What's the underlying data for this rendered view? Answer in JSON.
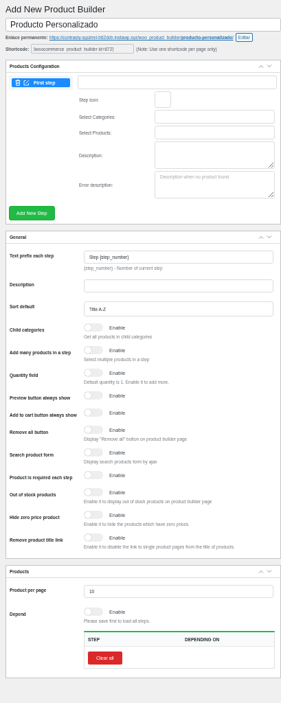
{
  "page_title": "Add New Product Builder",
  "title_value": "Producto Personalizado",
  "permalink": {
    "label": "Enlace permanente:",
    "url_base": "https://contrasty-squirrel-b62dcb.instawp.xyz/woo_product_builder/",
    "url_slug": "producto-personalizado",
    "url_end": "/",
    "edit_button": "Editar"
  },
  "shortcode": {
    "label": "Shortcode:",
    "value": "[woocommerce_product_builder id=672]",
    "note": "(Note: Use one shortcode per page only)"
  },
  "products_configuration": {
    "title": "Products Configuration",
    "steps": [
      {
        "label": "First step",
        "selected": true
      }
    ],
    "fields": [
      {
        "kind": "icon",
        "label": "Step icon:"
      },
      {
        "kind": "input",
        "label": "Select Categories:"
      },
      {
        "kind": "input",
        "label": "Select Products:"
      },
      {
        "kind": "textarea",
        "label": "Description:"
      },
      {
        "kind": "textarea",
        "label": "Error description:",
        "placeholder": "Description when no product found"
      }
    ],
    "add_button": "Add New Step"
  },
  "general": {
    "title": "General",
    "rows": [
      {
        "kind": "text",
        "label": "Text prefix each step",
        "value": "Step {step_number}",
        "hint": "{step_number} - Number of current step"
      },
      {
        "kind": "text",
        "label": "Description"
      },
      {
        "kind": "select",
        "label": "Sort default",
        "value": "Title A-Z"
      },
      {
        "kind": "toggle",
        "label": "Child categories",
        "on": false,
        "text": "Enable",
        "hint": "Get all products in child categories"
      },
      {
        "kind": "toggle",
        "label": "Add many products in a step",
        "on": false,
        "text": "Enable",
        "hint": "Select multiple products in a step"
      },
      {
        "kind": "toggle",
        "label": "Quantity field",
        "on": false,
        "text": "Enable",
        "hint": "Default quantity is 1. Enable it to add more."
      },
      {
        "kind": "toggle",
        "label": "Preview button always show",
        "on": false,
        "text": "Enable"
      },
      {
        "kind": "toggle",
        "label": "Add to cart button always show",
        "on": false,
        "text": "Enable"
      },
      {
        "kind": "toggle",
        "label": "Remove all button",
        "on": false,
        "text": "Enable",
        "hint": "Display \"Remove all\" button on product builder page"
      },
      {
        "kind": "toggle",
        "label": "Search product form",
        "on": false,
        "text": "Enable",
        "hint": "Display search products form by ajax"
      },
      {
        "kind": "toggle",
        "label": "Product is required each step",
        "on": false,
        "text": "Enable"
      },
      {
        "kind": "toggle",
        "label": "Out of stock products",
        "on": false,
        "text": "Enable",
        "hint": "Enable it to display out of stock products on product builder page"
      },
      {
        "kind": "toggle",
        "label": "Hide zero price product",
        "on": false,
        "text": "Enable",
        "hint": "Enable it to hide the products which have zero prices."
      },
      {
        "kind": "toggle",
        "label": "Remove product title link",
        "on": false,
        "text": "Enable",
        "hint": "Enable it to disable the link to single product pages from the title of products."
      }
    ]
  },
  "products": {
    "title": "Products",
    "rows": [
      {
        "kind": "text",
        "label": "Product per page",
        "value": "10"
      },
      {
        "kind": "toggle",
        "label": "Depend",
        "on": false,
        "text": "Enable",
        "hint": "Please save first to load all steps."
      }
    ],
    "table": {
      "columns": [
        "STEP",
        "DEPENDING ON"
      ],
      "clear_button": "Clear all"
    }
  }
}
